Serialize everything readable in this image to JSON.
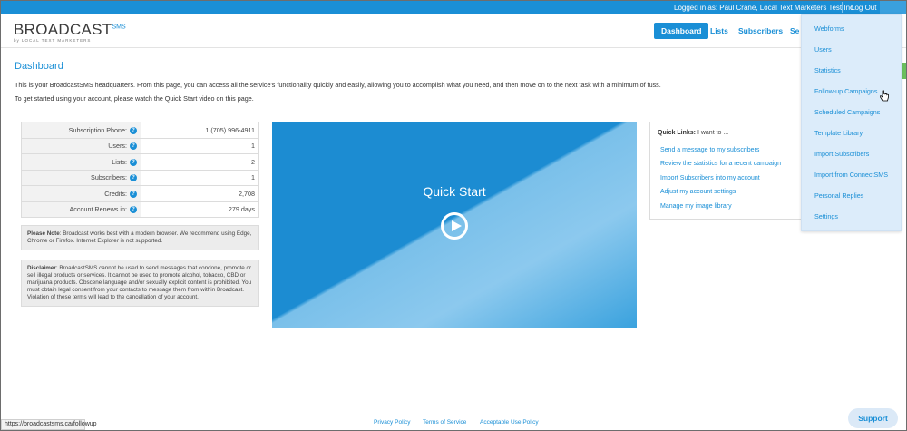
{
  "topbar": {
    "logged_in_text": "Logged in as: Paul Crane, Local Text Marketers Test Inc.",
    "logout_label": "Log Out"
  },
  "logo": {
    "main": "BROADCAST",
    "suffix": "SMS",
    "tagline": "by LOCAL TEXT MARKETERS"
  },
  "nav": {
    "dashboard": "Dashboard",
    "lists": "Lists",
    "subscribers": "Subscribers",
    "partial": "Se"
  },
  "page": {
    "title": "Dashboard",
    "intro1": "This is your BroadcastSMS headquarters. From this page, you can access all the service's functionality quickly and easily, allowing you to accomplish what you need, and then move on to the next task with a minimum of fuss.",
    "intro2": "To get started using your account, please watch the Quick Start video on this page."
  },
  "stats": [
    {
      "label": "Subscription Phone:",
      "value": "1 (705) 996-4911"
    },
    {
      "label": "Users:",
      "value": "1"
    },
    {
      "label": "Lists:",
      "value": "2"
    },
    {
      "label": "Subscribers:",
      "value": "1"
    },
    {
      "label": "Credits:",
      "value": "2,708"
    },
    {
      "label": "Account Renews in:",
      "value": "279 days"
    }
  ],
  "help_glyph": "?",
  "note": {
    "title": "Please Note",
    "text": ": Broadcast works best with a modern browser. We recommend using Edge, Chrome or Firefox. Internet Explorer is not supported."
  },
  "disclaimer": {
    "title": "Disclaimer",
    "text": ": BroadcastSMS cannot be used to send messages that condone, promote or sell illegal products or services. It cannot be used to promote alcohol, tobacco, CBD or marijuana products. Obscene language and/or sexually explicit content is prohibited. You must obtain legal consent from your contacts to message them from within Broadcast. Violation of these terms will lead to the cancellation of your account."
  },
  "video": {
    "title": "Quick Start"
  },
  "quick_links": {
    "heading_bold": "Quick Links:",
    "heading_rest": " I want to ...",
    "links": [
      "Send a message to my subscribers",
      "Review the statistics for a recent campaign",
      "Import Subscribers into my account",
      "Adjust my account settings",
      "Manage my image library"
    ]
  },
  "dropdown": [
    "Webforms",
    "Users",
    "Statistics",
    "Follow-up Campaigns",
    "Scheduled Campaigns",
    "Template Library",
    "Import Subscribers",
    "Import from ConnectSMS",
    "Personal Replies",
    "Settings"
  ],
  "footer": {
    "privacy": "Privacy Policy",
    "terms": "Terms of Service",
    "acceptable": "Acceptable Use Policy"
  },
  "status_url": "https://broadcastsms.ca/followup",
  "support_label": "Support",
  "colors": {
    "accent": "#1a8fd6",
    "dropdown_bg": "#dcecfa"
  }
}
